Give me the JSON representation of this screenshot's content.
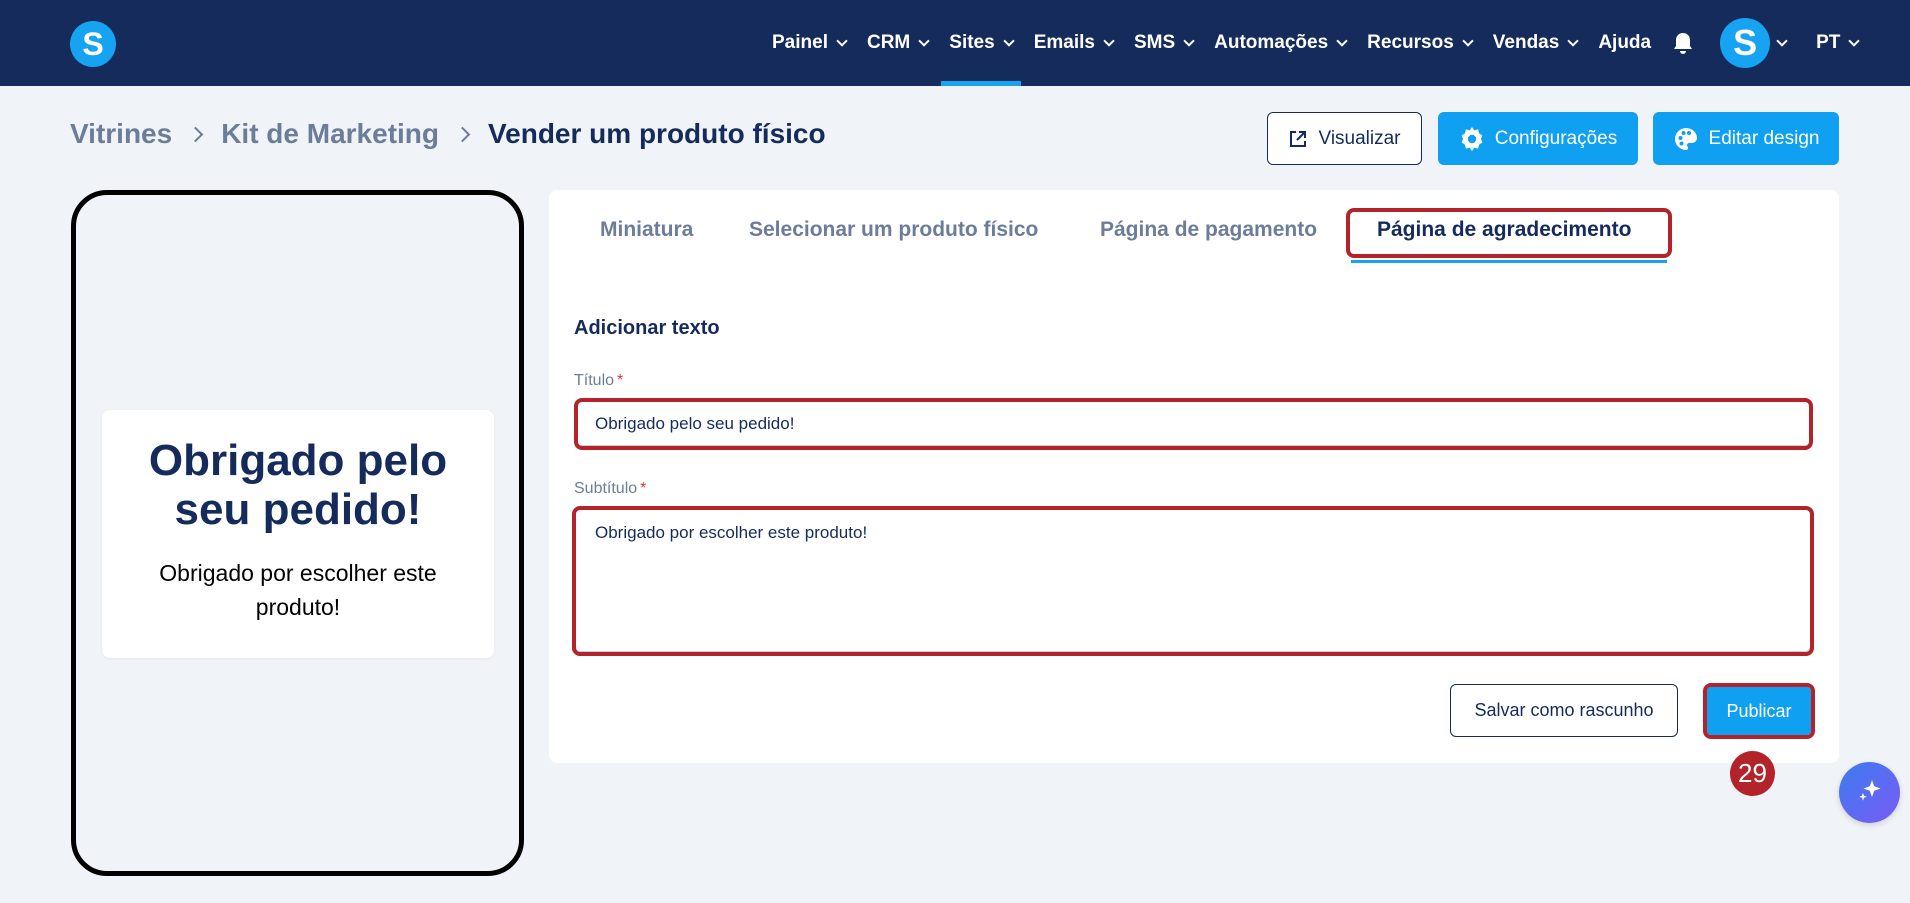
{
  "header": {
    "logo_letter": "S",
    "nav": [
      {
        "label": "Painel",
        "dropdown": true
      },
      {
        "label": "CRM",
        "dropdown": true
      },
      {
        "label": "Sites",
        "dropdown": true,
        "active": true
      },
      {
        "label": "Emails",
        "dropdown": true
      },
      {
        "label": "SMS",
        "dropdown": true
      },
      {
        "label": "Automações",
        "dropdown": true
      },
      {
        "label": "Recursos",
        "dropdown": true
      },
      {
        "label": "Vendas",
        "dropdown": true
      },
      {
        "label": "Ajuda",
        "dropdown": false
      }
    ],
    "bell_icon": "bell-icon",
    "avatar_letter": "S",
    "language": "PT",
    "accent_color": "#16a3f2",
    "bg_color": "#152b5c"
  },
  "breadcrumb": {
    "items": [
      "Vitrines",
      "Kit de Marketing"
    ],
    "current": "Vender um produto físico"
  },
  "actions": {
    "preview_label": "Visualizar",
    "settings_label": "Configurações",
    "edit_design_label": "Editar design"
  },
  "preview": {
    "title": "Obrigado pelo seu pedido!",
    "subtitle": "Obrigado por escolher este produto!"
  },
  "tabs": [
    {
      "label": "Miniatura"
    },
    {
      "label": "Selecionar um produto físico"
    },
    {
      "label": "Página de pagamento"
    },
    {
      "label": "Página de agradecimento",
      "active": true
    }
  ],
  "form": {
    "section_title": "Adicionar texto",
    "title_label": "Título",
    "title_value": "Obrigado pelo seu pedido!",
    "subtitle_label": "Subtítulo",
    "subtitle_value": "Obrigado por escolher este produto!",
    "required_mark": "*",
    "draft_label": "Salvar como rascunho",
    "publish_label": "Publicar"
  },
  "step_badge": "29",
  "highlight_color": "#b3242a"
}
